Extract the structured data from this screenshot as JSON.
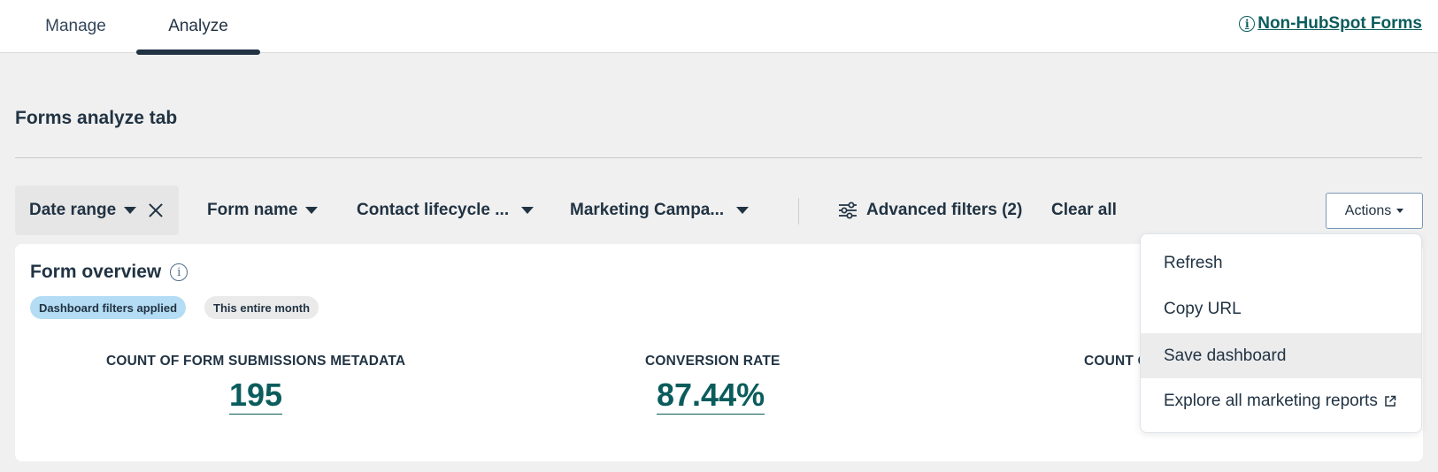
{
  "tabs": [
    {
      "label": "Manage",
      "active": false
    },
    {
      "label": "Analyze",
      "active": true
    }
  ],
  "header_link": {
    "label": "Non-HubSpot Forms",
    "icon": "info-icon"
  },
  "page_title": "Forms analyze tab",
  "filters": {
    "date_range": "Date range",
    "form_name": "Form name",
    "contact_lifecycle": "Contact lifecycle ...",
    "marketing_campaign": "Marketing Campa...",
    "advanced": "Advanced filters (2)",
    "clear_all": "Clear all"
  },
  "actions_button": "Actions",
  "card": {
    "title": "Form overview",
    "pills": {
      "applied": "Dashboard filters applied",
      "period": "This entire month"
    },
    "metrics": [
      {
        "label": "COUNT OF FORM SUBMISSIONS METADATA",
        "value": "195"
      },
      {
        "label": "CONVERSION RATE",
        "value": "87.44%"
      },
      {
        "label": "COUNT O"
      }
    ]
  },
  "actions_menu": {
    "items": [
      {
        "label": "Refresh",
        "highlighted": false
      },
      {
        "label": "Copy URL",
        "highlighted": false
      },
      {
        "label": "Save dashboard",
        "highlighted": true
      },
      {
        "label": "Explore all marketing reports",
        "highlighted": false,
        "icon": "external-link-icon"
      }
    ]
  },
  "colors": {
    "accent": "#0b5c5c",
    "text": "#213343",
    "pill_blue": "#b4dcf4",
    "background": "#f0f0f0"
  }
}
